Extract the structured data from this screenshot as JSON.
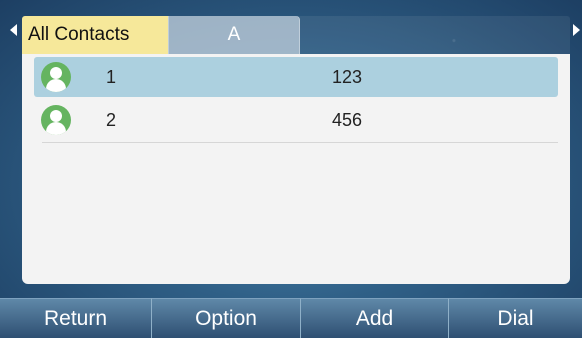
{
  "tabs": [
    {
      "label": "All Contacts",
      "active": true
    },
    {
      "label": "A",
      "active": false
    }
  ],
  "contacts": [
    {
      "name": "1",
      "number": "123",
      "selected": true
    },
    {
      "name": "2",
      "number": "456",
      "selected": false
    }
  ],
  "softkeys": [
    {
      "label": "Return"
    },
    {
      "label": "Option"
    },
    {
      "label": "Add"
    },
    {
      "label": "Dial"
    }
  ],
  "colors": {
    "active_tab": "#f6e89a",
    "selected_row": "#acd0df",
    "avatar": "#65b460",
    "panel": "#f3f3f3"
  }
}
